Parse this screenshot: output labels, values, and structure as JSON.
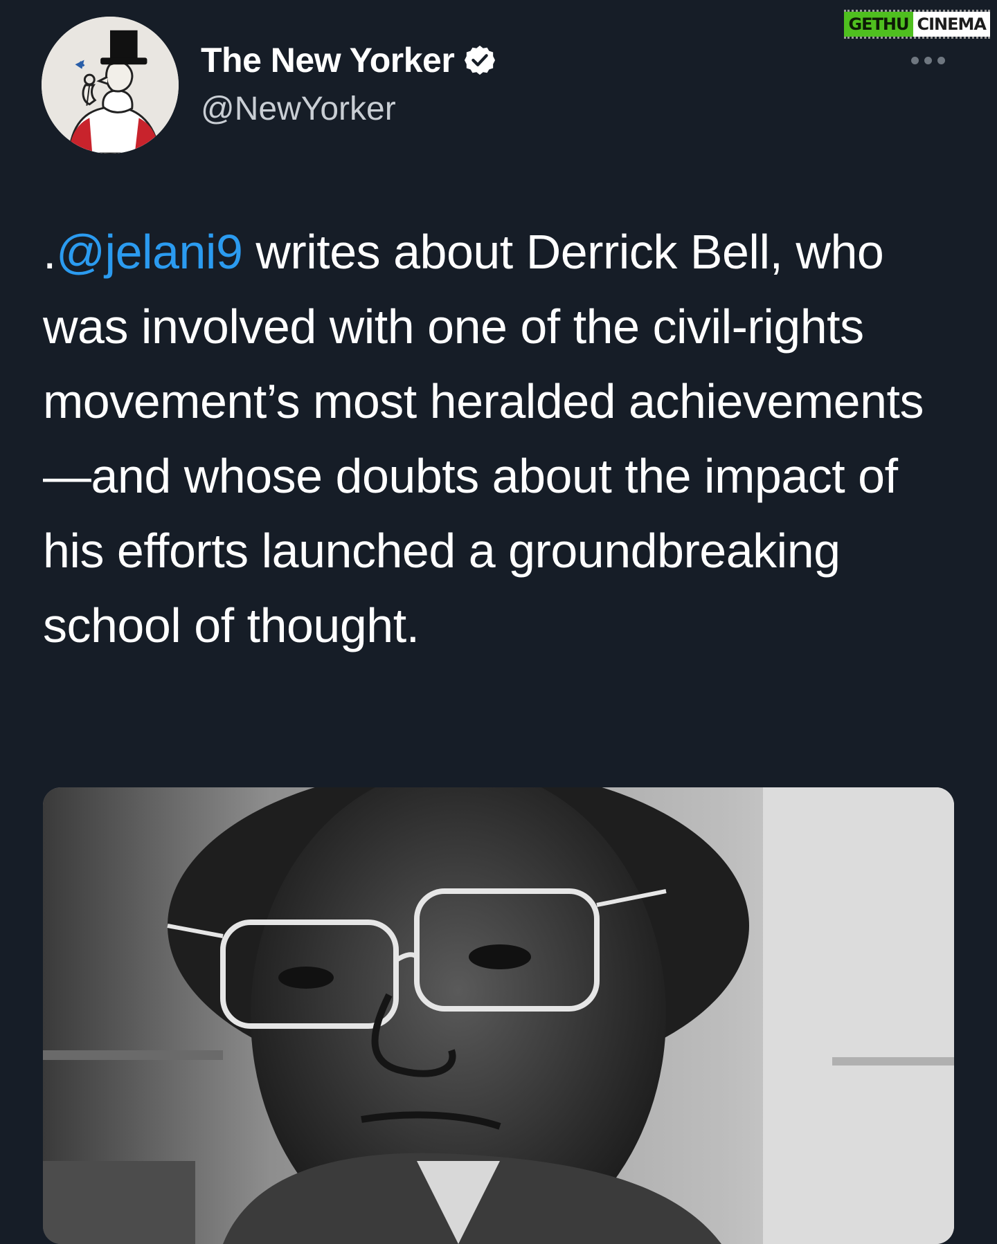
{
  "watermark": {
    "part_a": "GETHU",
    "part_b": "CINEMA"
  },
  "tweet": {
    "author": {
      "display_name": "The New Yorker",
      "handle": "@NewYorker",
      "verified": true,
      "avatar_icon": "eustace-tilley-icon"
    },
    "text": {
      "prefix": ".",
      "mention": "@jelani9",
      "body": " writes about Derrick Bell, who was involved with one of the civil-rights movement’s most heralded achievements—and whose doubts about the impact of his efforts launched a groundbreaking school of thought."
    },
    "media": {
      "kind": "black-and-white portrait photo"
    }
  },
  "colors": {
    "background": "#161d27",
    "mention": "#2b9bf0",
    "handle": "#c9ced4",
    "watermark_green": "#4fbf1f"
  }
}
